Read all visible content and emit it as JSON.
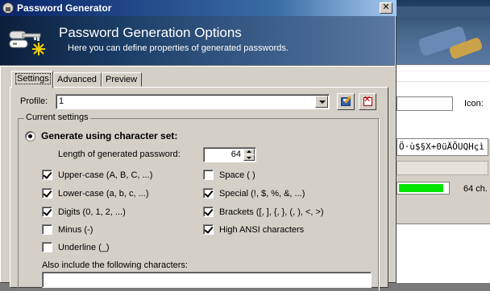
{
  "background_window": {
    "icon_label": "Icon:",
    "password_preview": "Ö·ù$§X+0üÄÕUQHçì",
    "quality_label": "64 ch.",
    "quality_fraction": 0.88,
    "quality_color": "#00e600"
  },
  "dialog": {
    "title": "Password Generator",
    "close_label": "✕",
    "banner": {
      "title": "Password Generation Options",
      "subtitle": "Here you can define properties of generated passwords."
    },
    "tabs": [
      {
        "label": "Settings",
        "active": true
      },
      {
        "label": "Advanced",
        "active": false
      },
      {
        "label": "Preview",
        "active": false
      }
    ],
    "profile": {
      "label": "Profile:",
      "value": "1",
      "save_icon": "save-profile-icon",
      "delete_icon": "delete-profile-icon"
    },
    "current_settings": {
      "group_label": "Current settings",
      "generate_charset_label": "Generate using character set:",
      "length_label": "Length of generated password:",
      "length_value": "64",
      "options_left": [
        {
          "label": "Upper-case (A, B, C, ...)",
          "checked": true
        },
        {
          "label": "Lower-case (a, b, c, ...)",
          "checked": true
        },
        {
          "label": "Digits (0, 1, 2, ...)",
          "checked": true
        },
        {
          "label": "Minus (-)",
          "checked": false
        },
        {
          "label": "Underline (_)",
          "checked": false
        }
      ],
      "options_right": [
        {
          "label": "Space ( )",
          "checked": false
        },
        {
          "label": "Special (!, $, %, &, ...)",
          "checked": true
        },
        {
          "label": "Brackets ([, ], {, }, (, ), <, >)",
          "checked": true
        },
        {
          "label": "High ANSI characters",
          "checked": true
        }
      ],
      "also_include_label": "Also include the following characters:",
      "also_include_value": ""
    }
  },
  "colors": {
    "titlebar_start": "#0a246a",
    "titlebar_end": "#a6caf0",
    "face": "#d4d0c8"
  }
}
